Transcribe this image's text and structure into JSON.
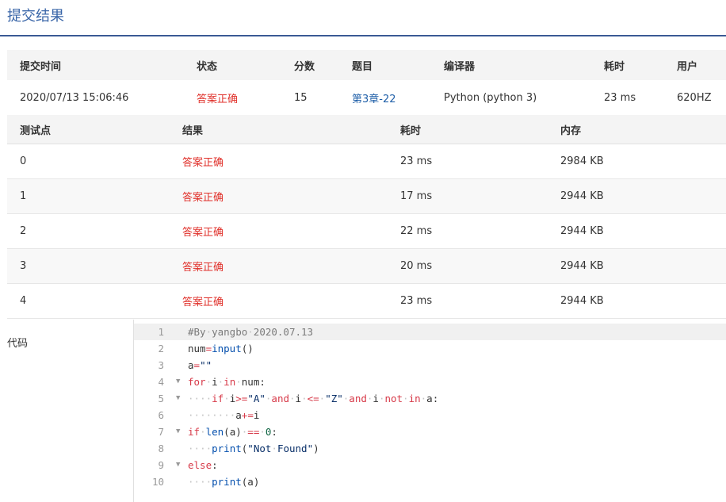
{
  "page": {
    "title": "提交结果"
  },
  "summary": {
    "headers": [
      "提交时间",
      "状态",
      "分数",
      "题目",
      "编译器",
      "耗时",
      "用户"
    ],
    "values": [
      "2020/07/13 15:06:46",
      "答案正确",
      "15",
      "第3章-22",
      "Python (python 3)",
      "23 ms",
      "620HZ"
    ]
  },
  "cases": {
    "headers": [
      "测试点",
      "结果",
      "耗时",
      "内存"
    ],
    "rows": [
      [
        "0",
        "答案正确",
        "23 ms",
        "2984 KB"
      ],
      [
        "1",
        "答案正确",
        "17 ms",
        "2944 KB"
      ],
      [
        "2",
        "答案正确",
        "22 ms",
        "2944 KB"
      ],
      [
        "3",
        "答案正确",
        "20 ms",
        "2944 KB"
      ],
      [
        "4",
        "答案正确",
        "23 ms",
        "2944 KB"
      ]
    ]
  },
  "code": {
    "label": "代码",
    "lines": [
      {
        "num": "1",
        "fold": false,
        "text": "#By·yangbo·2020.07.13"
      },
      {
        "num": "2",
        "fold": false,
        "text": "num=input()"
      },
      {
        "num": "3",
        "fold": false,
        "text": "a=\"\""
      },
      {
        "num": "4",
        "fold": true,
        "text": "for·i·in·num:"
      },
      {
        "num": "5",
        "fold": true,
        "text": "····if·i>=\"A\"·and·i·<=·\"Z\"·and·i·not·in·a:"
      },
      {
        "num": "6",
        "fold": false,
        "text": "········a+=i"
      },
      {
        "num": "7",
        "fold": true,
        "text": "if·len(a)·==·0:"
      },
      {
        "num": "8",
        "fold": false,
        "text": "····print(\"Not·Found\")"
      },
      {
        "num": "9",
        "fold": true,
        "text": "else:"
      },
      {
        "num": "10",
        "fold": false,
        "text": "····print(a)"
      }
    ]
  },
  "colors": {
    "accent": "#3a5a94",
    "success": "#e0312b",
    "link": "#1f5fa8"
  }
}
